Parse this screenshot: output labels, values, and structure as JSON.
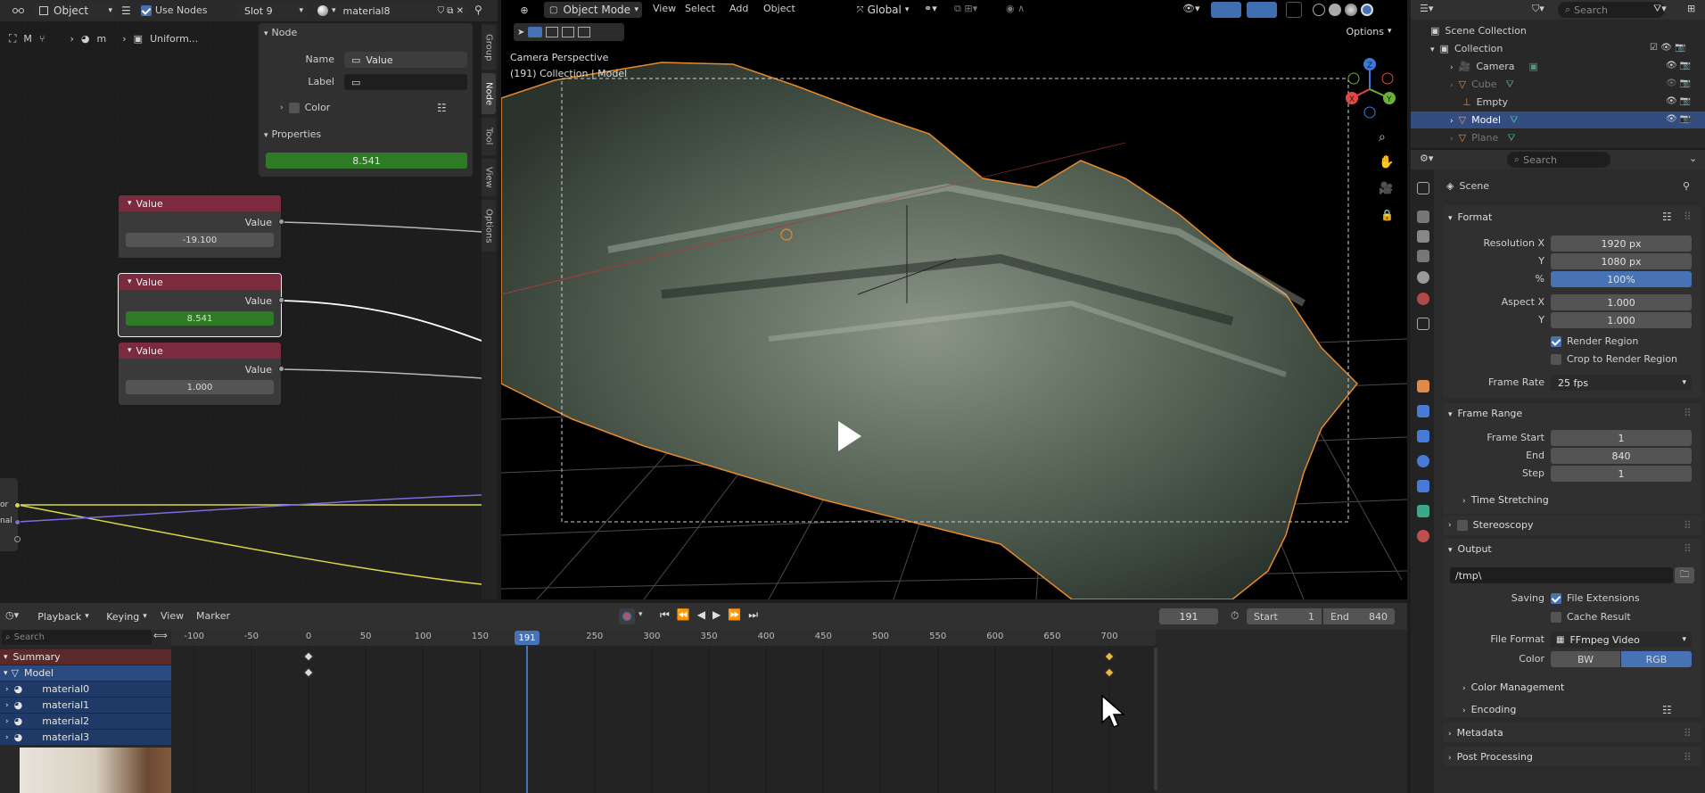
{
  "colors": {
    "accent": "#4772b3",
    "node_header": "#7c2a3d",
    "value_green": "#2f7a25",
    "keyframe_white": "#d9d9d9",
    "keyframe_yellow": "#e8b93a",
    "selection_orange": "#e88a2c"
  },
  "node_editor": {
    "header": {
      "mode": "Object",
      "use_nodes": "Use Nodes",
      "slot": "Slot 9",
      "material": "material8"
    },
    "breadcrumb": [
      "M",
      "m",
      "Uniform..."
    ],
    "sidebar": {
      "node_section": "Node",
      "name_label": "Name",
      "name_value": "Value",
      "label_label": "Label",
      "label_value": "",
      "color_label": "Color",
      "properties_section": "Properties",
      "properties_value": "8.541",
      "tabs": [
        "Group",
        "Node",
        "Tool",
        "View",
        "Options"
      ]
    },
    "nodes": [
      {
        "title": "Value",
        "output": "Value",
        "value": "-19.100",
        "selected": false
      },
      {
        "title": "Value",
        "output": "Value",
        "value": "8.541",
        "selected": true
      },
      {
        "title": "Value",
        "output": "Value",
        "value": "1.000",
        "selected": false
      }
    ],
    "partial_node": {
      "socket1": "or",
      "socket2": "nal"
    }
  },
  "viewport": {
    "header": {
      "mode": "Object Mode",
      "menus": [
        "View",
        "Select",
        "Add",
        "Object"
      ],
      "orientation": "Global"
    },
    "overlay_title": "Camera Perspective",
    "overlay_subtitle": "(191) Collection | Model",
    "options": "Options",
    "gizmo_axes": [
      "X",
      "Y",
      "Z"
    ]
  },
  "outliner": {
    "search_placeholder": "Search",
    "items": [
      {
        "label": "Scene Collection",
        "depth": 0
      },
      {
        "label": "Collection",
        "depth": 1
      },
      {
        "label": "Camera",
        "depth": 2
      },
      {
        "label": "Cube",
        "depth": 2
      },
      {
        "label": "Empty",
        "depth": 2
      },
      {
        "label": "Model",
        "depth": 2,
        "selected": true
      },
      {
        "label": "Plane",
        "depth": 2
      }
    ]
  },
  "properties": {
    "search_placeholder": "Search",
    "scene": "Scene",
    "format": {
      "title": "Format",
      "res_x_label": "Resolution X",
      "res_x": "1920 px",
      "res_y_label": "Y",
      "res_y": "1080 px",
      "pct_label": "%",
      "pct": "100%",
      "aspect_x_label": "Aspect X",
      "aspect_x": "1.000",
      "aspect_y_label": "Y",
      "aspect_y": "1.000",
      "render_region": "Render Region",
      "crop": "Crop to Render Region",
      "frame_rate_label": "Frame Rate",
      "frame_rate": "25 fps"
    },
    "frame_range": {
      "title": "Frame Range",
      "start_label": "Frame Start",
      "start": "1",
      "end_label": "End",
      "end": "840",
      "step_label": "Step",
      "step": "1",
      "time_stretching": "Time Stretching"
    },
    "stereoscopy": "Stereoscopy",
    "output": {
      "title": "Output",
      "path": "/tmp\\",
      "saving_label": "Saving",
      "file_ext": "File Extensions",
      "cache": "Cache Result",
      "file_format_label": "File Format",
      "file_format": "FFmpeg Video",
      "color_label": "Color",
      "bw": "BW",
      "rgb": "RGB",
      "color_management": "Color Management",
      "encoding": "Encoding"
    },
    "metadata": "Metadata",
    "post_processing": "Post Processing"
  },
  "timeline": {
    "menus": [
      "Playback",
      "Keying",
      "View",
      "Marker"
    ],
    "current_frame": "191",
    "start_label": "Start",
    "start": "1",
    "end_label": "End",
    "end": "840",
    "search_placeholder": "Search",
    "ruler": [
      "-100",
      "-50",
      "0",
      "50",
      "100",
      "150",
      "191",
      "250",
      "300",
      "350",
      "400",
      "450",
      "500",
      "550",
      "600",
      "650",
      "700"
    ],
    "tracks": [
      "Summary",
      "Model",
      "material0",
      "material1",
      "material2",
      "material3"
    ],
    "keyframes": [
      0,
      700
    ]
  }
}
